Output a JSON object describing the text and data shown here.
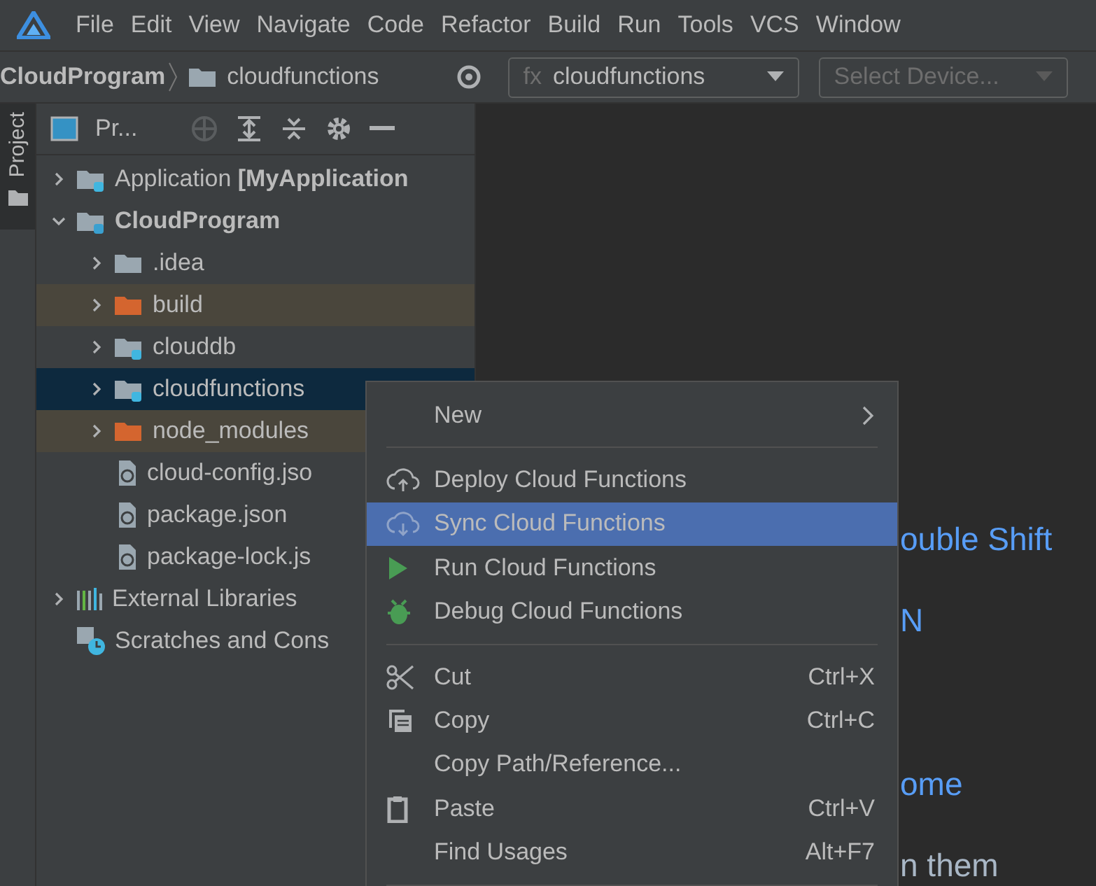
{
  "menu_bar": [
    "File",
    "Edit",
    "View",
    "Navigate",
    "Code",
    "Refactor",
    "Build",
    "Run",
    "Tools",
    "VCS",
    "Window"
  ],
  "nav_bar": {
    "breadcrumb": [
      "CloudProgram",
      "cloudfunctions"
    ],
    "run_config": {
      "prefix": "fx",
      "label": "cloudfunctions"
    },
    "device": {
      "placeholder": "Select Device...",
      "disabled": true
    }
  },
  "side_tab": {
    "label": "Project",
    "selected": true
  },
  "project_panel": {
    "title": "Pr...",
    "tree": [
      {
        "label": "Application **[MyApplication**",
        "kind": "module",
        "expanded": false,
        "bold": false,
        "selected": false,
        "excluded": false
      },
      {
        "label": "CloudProgram",
        "kind": "cloudmodule",
        "expanded": true,
        "bold": true,
        "selected": false,
        "excluded": false,
        "children": [
          {
            "label": ".idea",
            "kind": "folder",
            "expanded": false,
            "bold": false,
            "selected": false,
            "excluded": false
          },
          {
            "label": "build",
            "kind": "folder",
            "expanded": false,
            "bold": false,
            "selected": false,
            "excluded": true
          },
          {
            "label": "clouddb",
            "kind": "database",
            "expanded": false,
            "bold": false,
            "selected": false,
            "excluded": false
          },
          {
            "label": "cloudfunctions",
            "kind": "functions",
            "expanded": false,
            "bold": false,
            "selected": true,
            "excluded": false
          },
          {
            "label": "node_modules",
            "kind": "folder",
            "expanded": false,
            "bold": false,
            "selected": false,
            "excluded": true
          },
          {
            "label": "cloud-config.jso",
            "kind": "json",
            "bold": false,
            "selected": false,
            "excluded": false
          },
          {
            "label": "package.json",
            "kind": "json",
            "bold": false,
            "selected": false,
            "excluded": false
          },
          {
            "label": "package-lock.js",
            "kind": "json",
            "bold": false,
            "selected": false,
            "excluded": false
          }
        ]
      },
      {
        "label": "External Libraries",
        "kind": "libraries",
        "expanded": false,
        "bold": false,
        "selected": false,
        "excluded": false
      },
      {
        "label": "Scratches and Cons",
        "kind": "scratches",
        "bold": false,
        "selected": false,
        "excluded": false
      }
    ]
  },
  "editor_hints": [
    {
      "text": "ouble Shift",
      "kind": "link"
    },
    {
      "text": "N",
      "kind": "link"
    },
    {
      "text": "ome",
      "kind": "link"
    },
    {
      "text": "n them",
      "kind": "plain"
    }
  ],
  "context_menu": [
    {
      "kind": "submenu",
      "label": "New",
      "selected": false
    },
    {
      "kind": "separator"
    },
    {
      "kind": "deploy",
      "label": "Deploy Cloud Functions",
      "selected": false
    },
    {
      "kind": "sync",
      "label": "Sync Cloud Functions",
      "selected": true
    },
    {
      "kind": "run",
      "label": "Run Cloud Functions",
      "selected": false
    },
    {
      "kind": "debug",
      "label": "Debug Cloud Functions",
      "selected": false
    },
    {
      "kind": "separator"
    },
    {
      "kind": "cut",
      "label": "Cut",
      "shortcut": "Ctrl+X",
      "selected": false
    },
    {
      "kind": "copy",
      "label": "Copy",
      "shortcut": "Ctrl+C",
      "selected": false
    },
    {
      "kind": "plain",
      "label": "Copy Path/Reference...",
      "selected": false
    },
    {
      "kind": "paste",
      "label": "Paste",
      "shortcut": "Ctrl+V",
      "selected": false
    },
    {
      "kind": "plain",
      "label": "Find Usages",
      "shortcut": "Alt+F7",
      "selected": false
    },
    {
      "kind": "separator"
    }
  ]
}
